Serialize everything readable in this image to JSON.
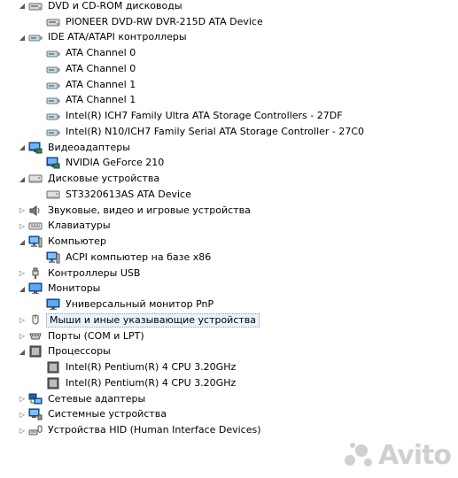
{
  "tree": [
    {
      "type": "category",
      "icon": "dvd-drive-icon",
      "label": "DVD и CD-ROM дисководы",
      "expanded": true
    },
    {
      "type": "device",
      "icon": "dvd-drive-icon",
      "label": "PIONEER DVD-RW  DVR-215D ATA Device"
    },
    {
      "type": "category",
      "icon": "ide-controller-icon",
      "label": "IDE ATA/ATAPI контроллеры",
      "expanded": true
    },
    {
      "type": "device",
      "icon": "ide-controller-icon",
      "label": "ATA Channel 0"
    },
    {
      "type": "device",
      "icon": "ide-controller-icon",
      "label": "ATA Channel 0"
    },
    {
      "type": "device",
      "icon": "ide-controller-icon",
      "label": "ATA Channel 1"
    },
    {
      "type": "device",
      "icon": "ide-controller-icon",
      "label": "ATA Channel 1"
    },
    {
      "type": "device",
      "icon": "ide-controller-icon",
      "label": "Intel(R) ICH7 Family Ultra ATA Storage Controllers - 27DF"
    },
    {
      "type": "device",
      "icon": "ide-controller-icon",
      "label": "Intel(R) N10/ICH7 Family Serial ATA Storage Controller - 27C0"
    },
    {
      "type": "category",
      "icon": "display-adapter-icon",
      "label": "Видеоадаптеры",
      "expanded": true
    },
    {
      "type": "device",
      "icon": "display-adapter-icon",
      "label": "NVIDIA GeForce 210"
    },
    {
      "type": "category",
      "icon": "disk-drive-icon",
      "label": "Дисковые устройства",
      "expanded": true
    },
    {
      "type": "device",
      "icon": "disk-drive-icon",
      "label": "ST3320613AS ATA Device"
    },
    {
      "type": "category",
      "icon": "speaker-icon",
      "label": "Звуковые, видео и игровые устройства",
      "expanded": false
    },
    {
      "type": "category",
      "icon": "keyboard-icon",
      "label": "Клавиатуры",
      "expanded": false
    },
    {
      "type": "category",
      "icon": "computer-icon",
      "label": "Компьютер",
      "expanded": true
    },
    {
      "type": "device",
      "icon": "computer-icon",
      "label": "ACPI компьютер на базе x86"
    },
    {
      "type": "category",
      "icon": "usb-icon",
      "label": "Контроллеры USB",
      "expanded": false
    },
    {
      "type": "category",
      "icon": "monitor-icon",
      "label": "Мониторы",
      "expanded": true
    },
    {
      "type": "device",
      "icon": "monitor-icon",
      "label": "Универсальный монитор PnP"
    },
    {
      "type": "category",
      "icon": "mouse-icon",
      "label": "Мыши и иные указывающие устройства",
      "expanded": false,
      "selected": true
    },
    {
      "type": "category",
      "icon": "port-icon",
      "label": "Порты (COM и LPT)",
      "expanded": false
    },
    {
      "type": "category",
      "icon": "processor-icon",
      "label": "Процессоры",
      "expanded": true
    },
    {
      "type": "device",
      "icon": "processor-icon",
      "label": "Intel(R) Pentium(R) 4 CPU 3.20GHz"
    },
    {
      "type": "device",
      "icon": "processor-icon",
      "label": "Intel(R) Pentium(R) 4 CPU 3.20GHz"
    },
    {
      "type": "category",
      "icon": "network-adapter-icon",
      "label": "Сетевые адаптеры",
      "expanded": false
    },
    {
      "type": "category",
      "icon": "system-device-icon",
      "label": "Системные устройства",
      "expanded": false
    },
    {
      "type": "category",
      "icon": "hid-icon",
      "label": "Устройства HID (Human Interface Devices)",
      "expanded": false
    }
  ],
  "watermark": {
    "text": "Avito"
  }
}
